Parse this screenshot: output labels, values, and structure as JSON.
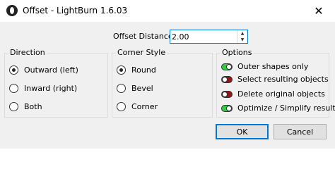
{
  "window": {
    "title": "Offset - LightBurn 1.6.03",
    "close_glyph": "✕"
  },
  "offset": {
    "label": "Offset Distance",
    "value": "2.00"
  },
  "direction": {
    "title": "Direction",
    "options": [
      "Outward (left)",
      "Inward (right)",
      "Both"
    ],
    "selected": "Outward (left)"
  },
  "corner_style": {
    "title": "Corner Style",
    "options": [
      "Round",
      "Bevel",
      "Corner"
    ],
    "selected": "Round"
  },
  "options": {
    "title": "Options",
    "items": [
      {
        "label": "Outer shapes only",
        "state": "on"
      },
      {
        "label": "Select resulting objects",
        "state": "off"
      },
      {
        "label": "Delete original objects",
        "state": "off"
      },
      {
        "label": "Optimize / Simplify results",
        "state": "on"
      }
    ]
  },
  "buttons": {
    "ok": "OK",
    "cancel": "Cancel"
  },
  "colors": {
    "toggle_on": "#2ecc40",
    "toggle_off": "#8b1a1a",
    "focus_accent": "#0078d7"
  }
}
